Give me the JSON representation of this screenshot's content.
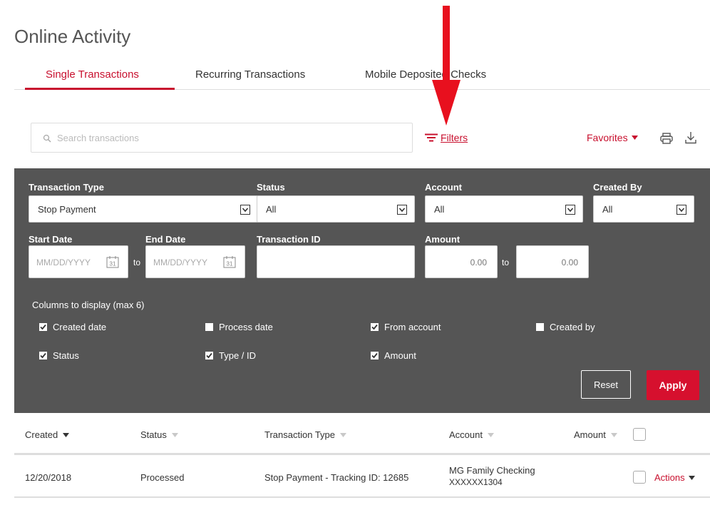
{
  "page": {
    "title": "Online Activity"
  },
  "tabs": [
    {
      "label": "Single Transactions",
      "active": true
    },
    {
      "label": "Recurring Transactions",
      "active": false
    },
    {
      "label": "Mobile Deposited Checks",
      "active": false
    }
  ],
  "toolbar": {
    "search_placeholder": "Search transactions",
    "filters_label": "Filters",
    "favorites_label": "Favorites"
  },
  "filters": {
    "transaction_type": {
      "label": "Transaction Type",
      "value": "Stop Payment"
    },
    "status": {
      "label": "Status",
      "value": "All"
    },
    "account": {
      "label": "Account",
      "value": "All"
    },
    "created_by": {
      "label": "Created By",
      "value": "All"
    },
    "start_date": {
      "label": "Start Date",
      "placeholder": "MM/DD/YYYY"
    },
    "end_date": {
      "label": "End Date",
      "placeholder": "MM/DD/YYYY"
    },
    "date_to": "to",
    "transaction_id": {
      "label": "Transaction ID",
      "value": ""
    },
    "amount": {
      "label": "Amount",
      "from": "0.00",
      "to": "0.00",
      "to_label": "to"
    },
    "calendar_day": "31",
    "columns_label": "Columns to display (max 6)",
    "columns": [
      {
        "label": "Created date",
        "checked": true
      },
      {
        "label": "Process date",
        "checked": false
      },
      {
        "label": "From account",
        "checked": true
      },
      {
        "label": "Created by",
        "checked": false
      },
      {
        "label": "Status",
        "checked": true
      },
      {
        "label": "Type / ID",
        "checked": true
      },
      {
        "label": "Amount",
        "checked": true
      }
    ],
    "reset_label": "Reset",
    "apply_label": "Apply"
  },
  "table": {
    "headers": [
      "Created",
      "Status",
      "Transaction Type",
      "Account",
      "Amount"
    ],
    "rows": [
      {
        "created": "12/20/2018",
        "status": "Processed",
        "type": "Stop Payment - Tracking ID: 12685",
        "account_name": "MG Family Checking",
        "account_number": "XXXXXX1304",
        "actions_label": "Actions"
      }
    ]
  },
  "colors": {
    "accent": "#c8102e",
    "panel": "#555555",
    "annotation_arrow": "#e8101e"
  }
}
